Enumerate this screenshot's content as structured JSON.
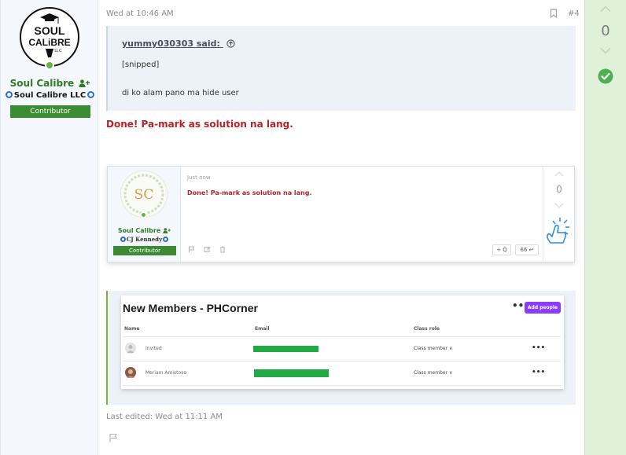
{
  "post": {
    "timestamp": "Wed at 10:46 AM",
    "number": "#4",
    "last_edited": "Last edited: Wed at 11:11 AM"
  },
  "user": {
    "logo_lines": [
      "SOUL",
      "CALiBRE",
      "LLC"
    ],
    "name": "Soul Calibre",
    "title": "Soul Calibre LLC",
    "role": "Contributor"
  },
  "quote": {
    "author": "yummy030303 said:",
    "line1": "[snipped]",
    "line2": "di ko alam pano ma hide user"
  },
  "message": {
    "text": "Done! Pa-mark as solution na lang."
  },
  "votes": {
    "count": "0"
  },
  "screenshot1": {
    "time": "Just now",
    "text": "Done! Pa-mark as solution na lang.",
    "username": "Soul Calibre",
    "user_title": "CJ Kennedy",
    "role": "Contributor",
    "vote_count": "0",
    "btn_quote": "+ Q",
    "btn_reply": "66 ↩"
  },
  "screenshot2": {
    "title": "New Members - PHCorner",
    "more": "•••",
    "add_button": "Add people",
    "columns": {
      "name": "Name",
      "email": "Email",
      "role": "Class role"
    },
    "rows": [
      {
        "name": "Invited",
        "role": "Class member ∨",
        "email_fill": 0.79
      },
      {
        "name": "Meriam Amistoso",
        "role": "Class member ∨",
        "email_fill": 0.9
      }
    ],
    "row_more": "•••"
  },
  "colors": {
    "username_green": "#317b22",
    "badge_green": "#3b8b32",
    "message_red": "#b3252a",
    "vote_bg": "#dff1d8",
    "solution_green": "#4caf50",
    "accent_purple": "#8b3dff"
  }
}
